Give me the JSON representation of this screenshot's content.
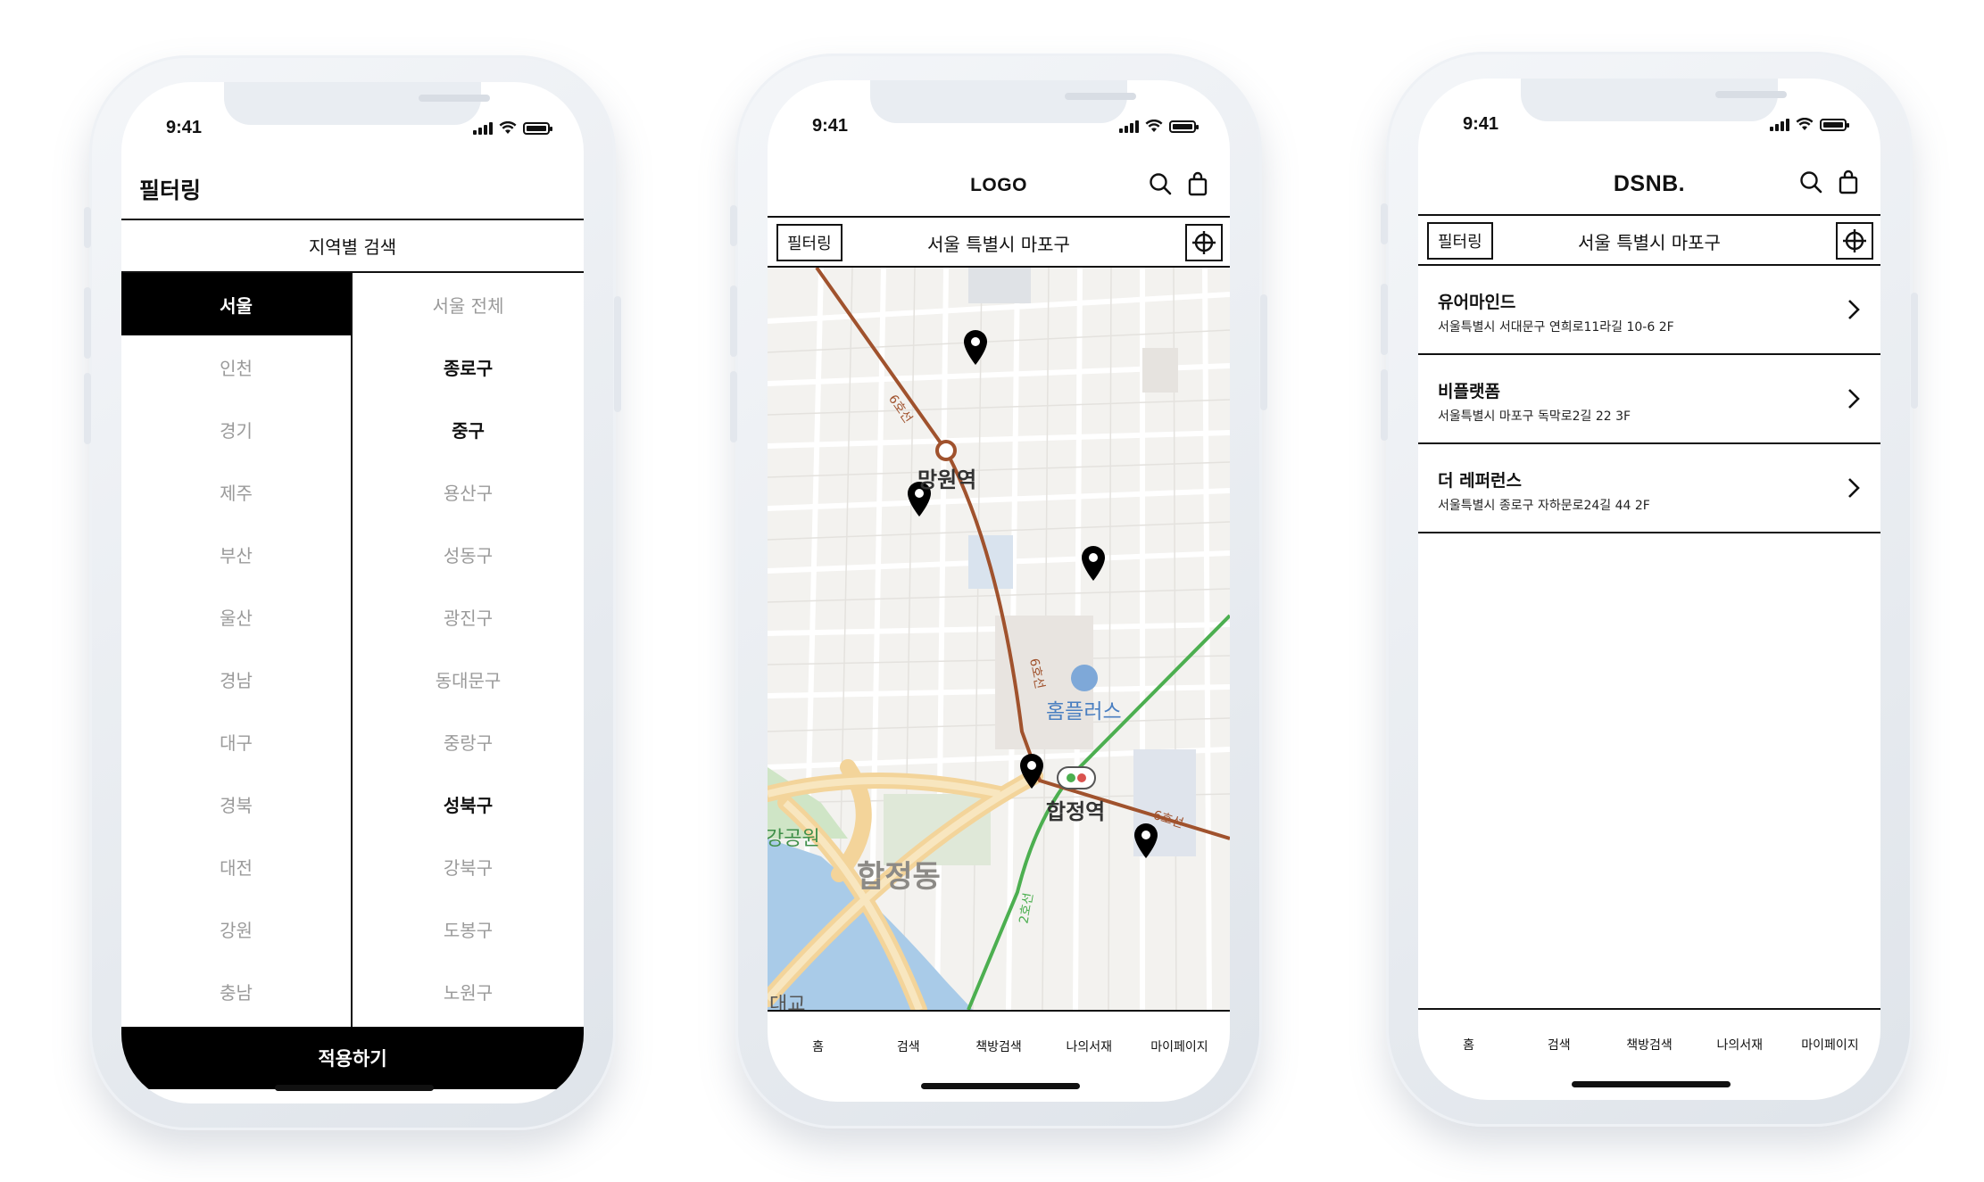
{
  "status_bar": {
    "time": "9:41"
  },
  "screen_filter": {
    "title": "필터링",
    "section_header": "지역별 검색",
    "provinces": [
      {
        "label": "서울",
        "active": true
      },
      {
        "label": "인천",
        "active": false
      },
      {
        "label": "경기",
        "active": false
      },
      {
        "label": "제주",
        "active": false
      },
      {
        "label": "부산",
        "active": false
      },
      {
        "label": "울산",
        "active": false
      },
      {
        "label": "경남",
        "active": false
      },
      {
        "label": "대구",
        "active": false
      },
      {
        "label": "경북",
        "active": false
      },
      {
        "label": "대전",
        "active": false
      },
      {
        "label": "강원",
        "active": false
      },
      {
        "label": "충남",
        "active": false
      }
    ],
    "districts": [
      {
        "label": "서울 전체",
        "selected": false
      },
      {
        "label": "종로구",
        "selected": true
      },
      {
        "label": "중구",
        "selected": true
      },
      {
        "label": "용산구",
        "selected": false
      },
      {
        "label": "성동구",
        "selected": false
      },
      {
        "label": "광진구",
        "selected": false
      },
      {
        "label": "동대문구",
        "selected": false
      },
      {
        "label": "중랑구",
        "selected": false
      },
      {
        "label": "성북구",
        "selected": true
      },
      {
        "label": "강북구",
        "selected": false
      },
      {
        "label": "도봉구",
        "selected": false
      },
      {
        "label": "노원구",
        "selected": false
      }
    ],
    "apply_label": "적용하기"
  },
  "screen_map": {
    "logo": "LOGO",
    "filter_label": "필터링",
    "location": "서울 특별시 마포구",
    "map_labels": {
      "mangwon": "망원역",
      "hapjeong_station": "합정역",
      "homeplus": "홈플러스",
      "hapjeong_dong": "합정동",
      "line6_a": "6호선",
      "line6_b": "6호선",
      "line6_c": "6호선",
      "line2": "2호선",
      "park": "강공원",
      "bridge": "대교"
    },
    "tabs": [
      "홈",
      "검색",
      "책방검색",
      "나의서재",
      "마이페이지"
    ]
  },
  "screen_list": {
    "logo": "DSNB.",
    "filter_label": "필터링",
    "location": "서울 특별시 마포구",
    "stores": [
      {
        "name": "유어마인드",
        "address": "서울특별시 서대문구 연희로11라길 10-6 2F"
      },
      {
        "name": "비플랫폼",
        "address": "서울특별시 마포구 독막로2길 22 3F"
      },
      {
        "name": "더 레퍼런스",
        "address": "서울특별시 종로구 자하문로24길 44 2F"
      }
    ],
    "tabs": [
      "홈",
      "검색",
      "책방검색",
      "나의서재",
      "마이페이지"
    ]
  },
  "colors": {
    "line6": "#a0522d",
    "line2": "#4caf50",
    "river": "#a9cbe8",
    "road_major": "#f3d49a",
    "pin": "#000000"
  }
}
